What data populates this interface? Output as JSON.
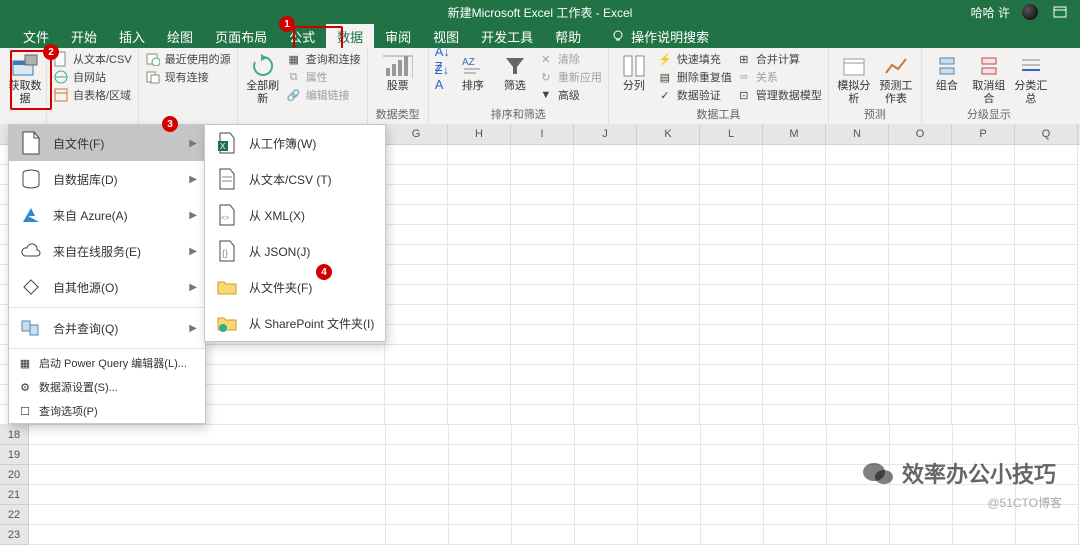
{
  "title": "新建Microsoft Excel 工作表  -  Excel",
  "user": "哈哈 许",
  "menu": [
    "文件",
    "开始",
    "插入",
    "绘图",
    "页面布局",
    "公式",
    "数据",
    "审阅",
    "视图",
    "开发工具",
    "帮助"
  ],
  "search_placeholder": "操作说明搜索",
  "ribbon": {
    "get_data": "获取数据",
    "from_text": "从文本/CSV",
    "from_web": "自网站",
    "from_table": "自表格/区域",
    "recent": "最近使用的源",
    "existing": "现有连接",
    "refresh": "全部刷新",
    "queries": "查询和连接",
    "props": "属性",
    "editlinks": "编辑链接",
    "stocks": "股票",
    "dtype_label": "数据类型",
    "sort_az": "A↓Z",
    "sort_za": "Z↓A",
    "sort": "排序",
    "filter": "筛选",
    "clear": "清除",
    "reapply": "重新应用",
    "advanced": "高级",
    "sort_filter": "排序和筛选",
    "text_to_col": "分列",
    "flash": "快速填充",
    "dup": "删除重复值",
    "valid": "数据验证",
    "consol": "合并计算",
    "rel": "关系",
    "dm": "管理数据模型",
    "tools": "数据工具",
    "whatif": "模拟分析",
    "forecast": "预测工作表",
    "forecast_grp": "预测",
    "group": "组合",
    "ungroup": "取消组合",
    "subtotal": "分类汇总",
    "outline": "分级显示"
  },
  "menu1": {
    "from_file": "自文件(F)",
    "from_db": "自数据库(D)",
    "from_azure": "来自 Azure(A)",
    "from_online": "来自在线服务(E)",
    "from_other": "自其他源(O)",
    "combine": "合并查询(Q)",
    "pq_editor": "启动 Power Query 编辑器(L)...",
    "ds_settings": "数据源设置(S)...",
    "query_opts": "查询选项(P)"
  },
  "menu2": {
    "from_wb": "从工作簿(W)",
    "from_txt": "从文本/CSV (T)",
    "from_xml": "从 XML(X)",
    "from_json": "从 JSON(J)",
    "from_folder": "从文件夹(F)",
    "from_sp": "从 SharePoint 文件夹(I)"
  },
  "columns": [
    "G",
    "H",
    "I",
    "J",
    "K",
    "L",
    "M",
    "N",
    "O",
    "P",
    "Q"
  ],
  "rows": [
    "18",
    "19",
    "20",
    "21",
    "22",
    "23"
  ],
  "watermark": "效率办公小技巧",
  "credit": "@51CTO博客"
}
